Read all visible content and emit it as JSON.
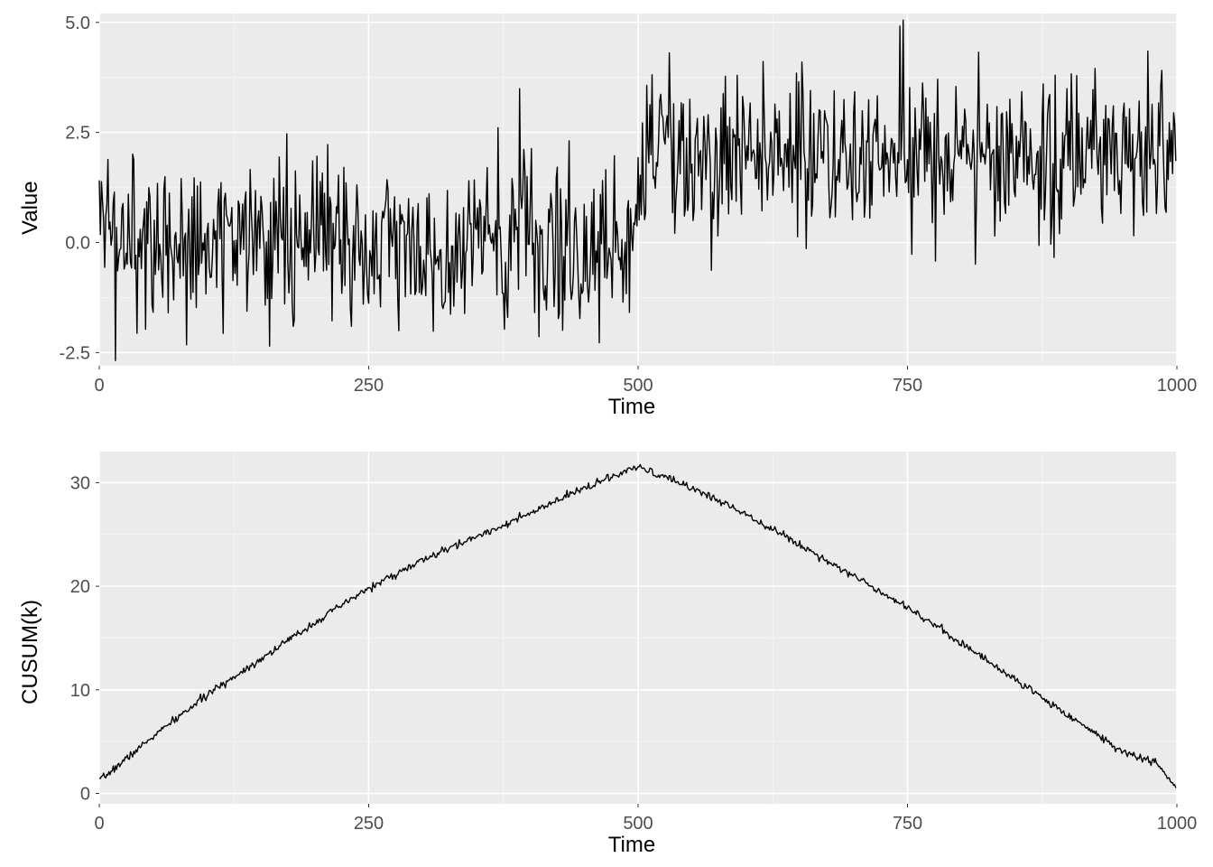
{
  "chart_data": [
    {
      "type": "line",
      "xlabel": "Time",
      "ylabel": "Value",
      "xlim": [
        0,
        1000
      ],
      "ylim": [
        -2.8,
        5.2
      ],
      "xticks": [
        0,
        250,
        500,
        750,
        1000
      ],
      "yticks": [
        -2.5,
        0.0,
        2.5,
        5.0
      ],
      "ytick_labels": [
        "-2.5",
        "0.0",
        "2.5",
        "5.0"
      ],
      "n": 1000,
      "noise_sd": 1.0,
      "segments": [
        {
          "start": 0,
          "end": 500,
          "mean": 0.0
        },
        {
          "start": 500,
          "end": 1000,
          "mean": 2.0
        }
      ],
      "description": "Gaussian noise series, mean 0 for t<500, mean 2 for t>=500"
    },
    {
      "type": "line",
      "xlabel": "Time",
      "ylabel": "CUSUM(k)",
      "xlim": [
        0,
        1000
      ],
      "ylim": [
        -1,
        33
      ],
      "xticks": [
        0,
        250,
        500,
        750,
        1000
      ],
      "yticks": [
        0,
        10,
        20,
        30
      ],
      "n": 1000,
      "description": "CUSUM statistic of the series above; roughly concave-triangular, ~0 at the ends, peak ~31.5 at k≈500",
      "approx_points": [
        {
          "x": 0,
          "y": 1.2
        },
        {
          "x": 50,
          "y": 5.5
        },
        {
          "x": 100,
          "y": 9.5
        },
        {
          "x": 150,
          "y": 13.0
        },
        {
          "x": 200,
          "y": 16.5
        },
        {
          "x": 250,
          "y": 19.8
        },
        {
          "x": 300,
          "y": 22.5
        },
        {
          "x": 350,
          "y": 24.8
        },
        {
          "x": 400,
          "y": 27.0
        },
        {
          "x": 450,
          "y": 29.5
        },
        {
          "x": 500,
          "y": 31.5
        },
        {
          "x": 550,
          "y": 29.5
        },
        {
          "x": 600,
          "y": 27.0
        },
        {
          "x": 650,
          "y": 24.0
        },
        {
          "x": 700,
          "y": 21.0
        },
        {
          "x": 750,
          "y": 18.0
        },
        {
          "x": 800,
          "y": 14.5
        },
        {
          "x": 850,
          "y": 11.0
        },
        {
          "x": 900,
          "y": 7.5
        },
        {
          "x": 950,
          "y": 4.0
        },
        {
          "x": 980,
          "y": 3.0
        },
        {
          "x": 1000,
          "y": 0.5
        }
      ]
    }
  ]
}
